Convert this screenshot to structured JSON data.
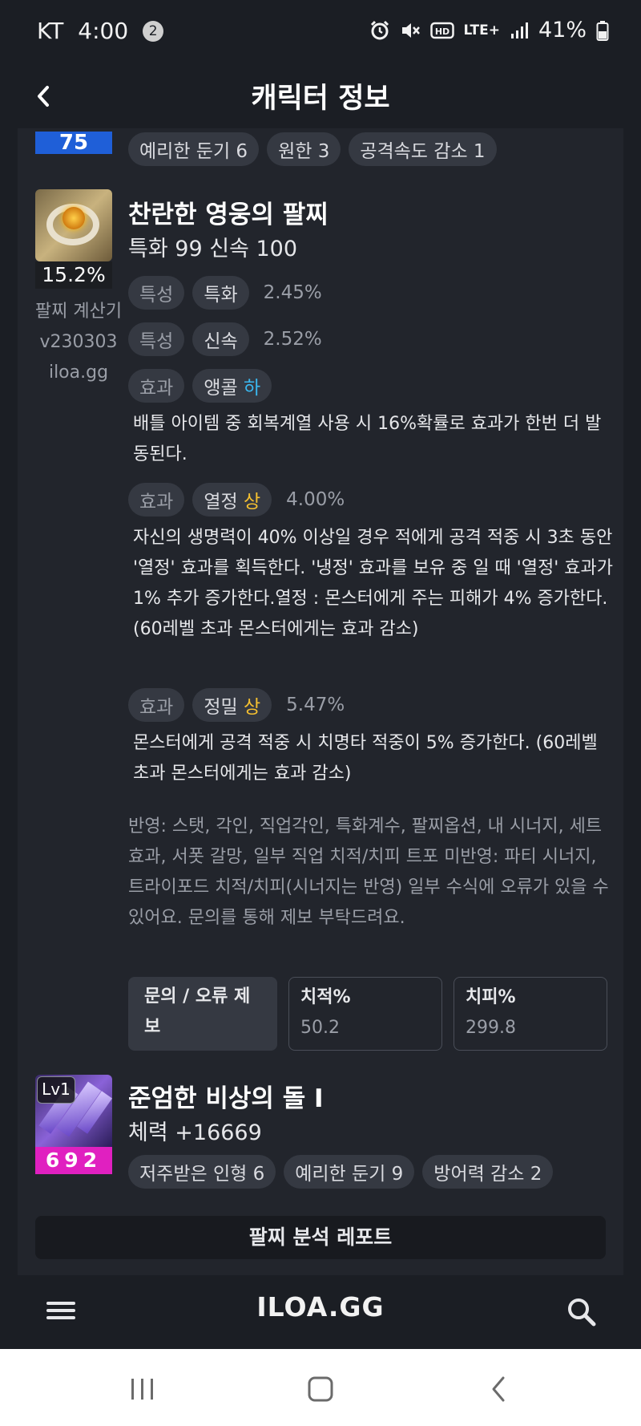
{
  "status_bar": {
    "carrier": "KT",
    "time": "4:00",
    "notification_count": "2",
    "battery": "41%",
    "network": "LTE+"
  },
  "header": {
    "title": "캐릭터 정보"
  },
  "top_row": {
    "level": "75",
    "chips": [
      "예리한 둔기 6",
      "원한 3",
      "공격속도 감소 1"
    ]
  },
  "bracelet": {
    "percent": "15.2%",
    "side_text": [
      "팔찌 계산기",
      "v230303",
      "iloa.gg"
    ],
    "title": "찬란한 영웅의 팔찌",
    "subtitle": "특화 99  신속 100",
    "stats": [
      {
        "type": "특성",
        "name": "특화",
        "value": "2.45%"
      },
      {
        "type": "특성",
        "name": "신속",
        "value": "2.52%"
      }
    ],
    "effects": [
      {
        "type": "효과",
        "name": "앵콜",
        "grade": "하",
        "value": "",
        "desc": "배틀 아이템 중 회복계열 사용 시 16%확률로 효과가 한번 더 발동된다."
      },
      {
        "type": "효과",
        "name": "열정",
        "grade": "상",
        "value": "4.00%",
        "desc": "자신의 생명력이 40% 이상일 경우 적에게 공격 적중 시 3초 동안 '열정' 효과를 획득한다. '냉정' 효과를 보유 중 일 때 '열정' 효과가 1% 추가 증가한다.열정 : 몬스터에게 주는 피해가 4% 증가한다. (60레벨 초과 몬스터에게는 효과 감소)"
      },
      {
        "type": "효과",
        "name": "정밀",
        "grade": "상",
        "value": "5.47%",
        "desc": "몬스터에게 공격 적중 시 치명타 적중이 5% 증가한다. (60레벨 초과 몬스터에게는 효과 감소)"
      }
    ],
    "note": "반영: 스탯, 각인, 직업각인, 특화계수, 팔찌옵션, 내 시너지, 세트효과, 서폿 갈망, 일부 직업 치적/치피 트포 미반영: 파티 시너지, 트라이포드 치적/치피(시너지는 반영) 일부 수식에 오류가 있을 수 있어요. 문의를 통해 제보 부탁드려요.",
    "report_button": "문의 / 오류 제보",
    "crit_rate_label": "치적%",
    "crit_rate_value": "50.2",
    "crit_dmg_label": "치피%",
    "crit_dmg_value": "299.8"
  },
  "stone": {
    "level": "Lv1",
    "number": "692",
    "title": "준엄한 비상의 돌 I",
    "subtitle": "체력 +16669",
    "chips": [
      "저주받은 인형 6",
      "예리한 둔기 9",
      "방어력 감소 2"
    ]
  },
  "analysis_button": "팔찌 분석 레포트",
  "bottom_nav": {
    "brand": "ILOA.GG"
  },
  "colors": {
    "background": "#1b1e24",
    "panel": "#22252c",
    "chip": "#353942",
    "grade_low": "#3ab8f0",
    "grade_high": "#f5c030",
    "level_blue": "#1f5fd8",
    "stone_magenta": "#e020c0"
  }
}
